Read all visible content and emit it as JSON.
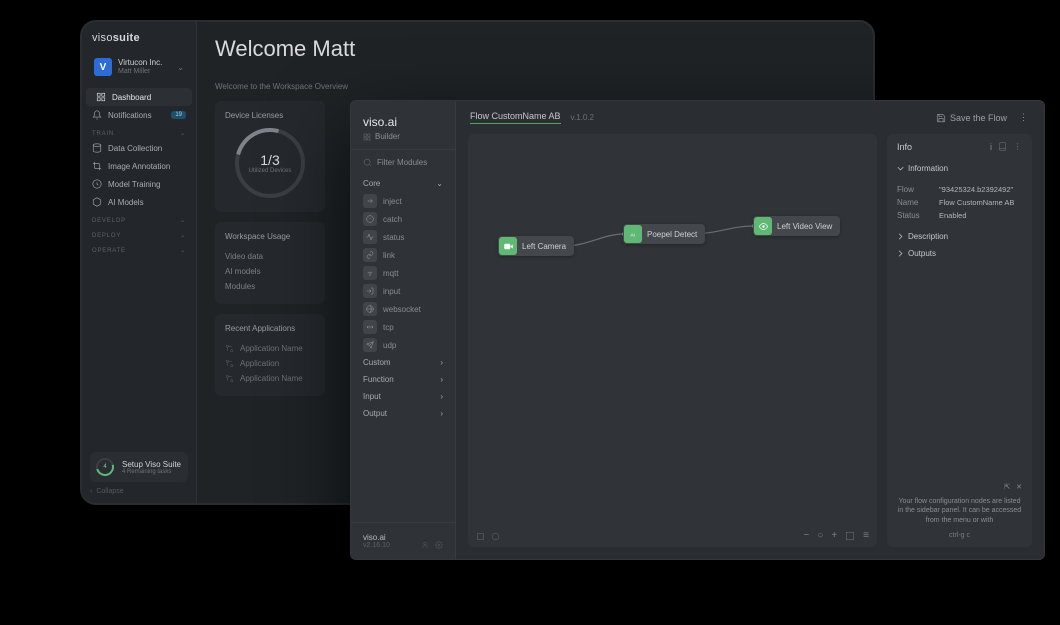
{
  "dashboard": {
    "brand_left": "viso",
    "brand_right": "suite",
    "org": {
      "logo_letter": "V",
      "name": "Virtucon Inc.",
      "user": "Matt Miller"
    },
    "nav": {
      "dashboard": "Dashboard",
      "notifications": "Notifications",
      "notifications_badge": "19",
      "train_label": "TRAIN",
      "data_collection": "Data Collection",
      "image_annotation": "Image Annotation",
      "model_training": "Model Training",
      "ai_models": "AI Models",
      "develop_label": "DEVELOP",
      "deploy_label": "DEPLOY",
      "operate_label": "OPERATE"
    },
    "setup": {
      "title": "Setup Viso Suite",
      "sub": "4 Remaining tasks",
      "progress": "4"
    },
    "collapse": "Collapse",
    "welcome": "Welcome Matt",
    "subtitle": "Welcome to the Workspace Overview",
    "licenses": {
      "title": "Device Licenses",
      "ratio": "1/3",
      "label": "Utilized Devices"
    },
    "usage": {
      "title": "Workspace Usage",
      "rows": [
        "Video data",
        "AI models",
        "Modules"
      ]
    },
    "recent": {
      "title": "Recent Applications",
      "rows": [
        "Application Name",
        "Application",
        "Application Name"
      ]
    }
  },
  "builder": {
    "brand": "viso.ai",
    "sub": "Builder",
    "filter": "Filter Modules",
    "groups": {
      "core": "Core",
      "custom": "Custom",
      "function": "Function",
      "input": "Input",
      "output": "Output"
    },
    "core_items": [
      "inject",
      "catch",
      "status",
      "link",
      "mqtt",
      "input",
      "websocket",
      "tcp",
      "udp"
    ],
    "footer_brand": "viso.ai",
    "footer_version": "v2.16.10",
    "flow_name": "Flow CustomName AB",
    "flow_version": "v.1.0.2",
    "save": "Save the Flow",
    "nodes": {
      "left_camera": "Left Camera",
      "people_detect": "Poepel Detect",
      "left_video_view": "Left Video View"
    },
    "info": {
      "title": "Info",
      "information": "Information",
      "flow_label": "Flow",
      "flow_value": "\"93425324.b2392492\"",
      "name_label": "Name",
      "name_value": "Flow CustomName AB",
      "status_label": "Status",
      "status_value": "Enabled",
      "description": "Description",
      "outputs": "Outputs",
      "note": "Your flow configuration nodes are listed in the sidebar panel. It can be accessed from the menu or with",
      "kbd": "ctrl-g   c"
    }
  }
}
